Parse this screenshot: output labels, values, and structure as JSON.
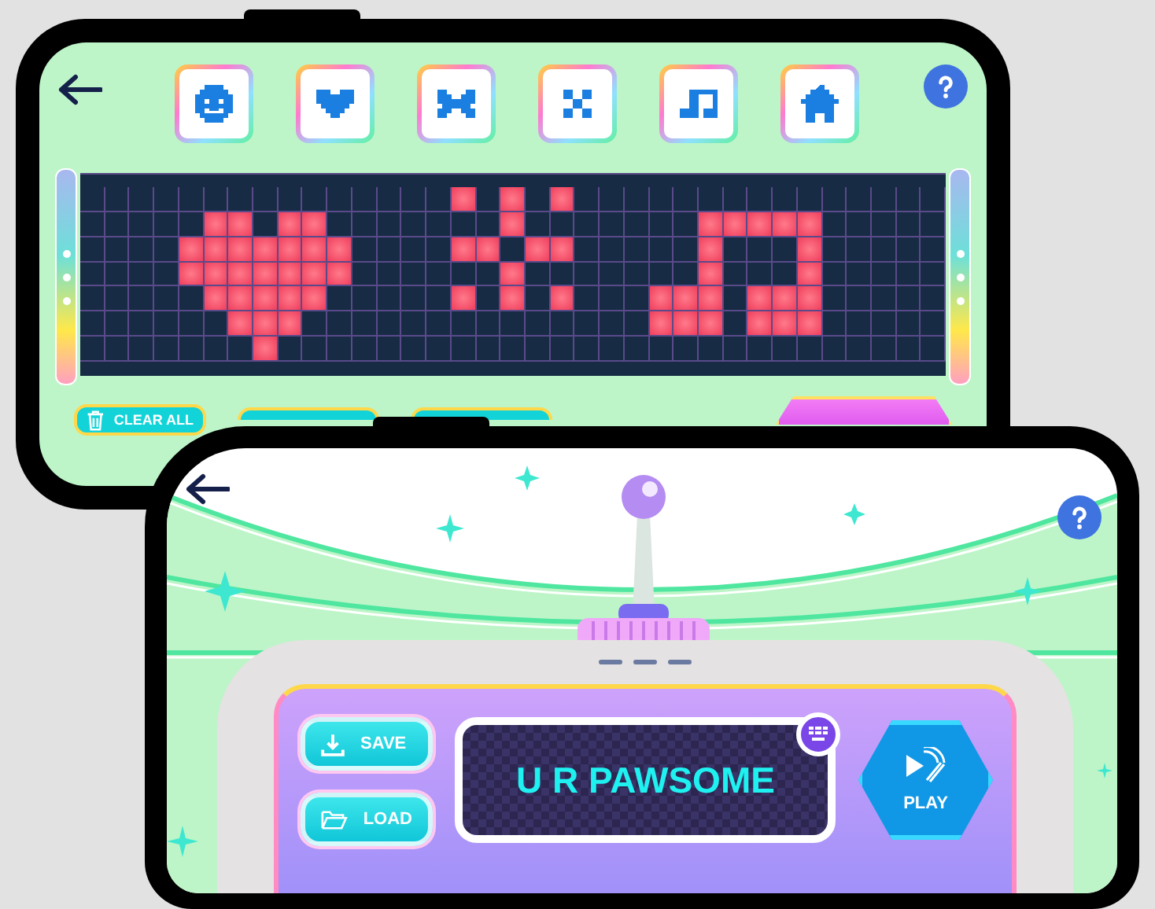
{
  "back_phone": {
    "matrix": {
      "rows": [
        {
          "cells": [
            false,
            false,
            false,
            false,
            false,
            false,
            false,
            false,
            false,
            false,
            false,
            false,
            false,
            false,
            false,
            true,
            false,
            true,
            false,
            true,
            false,
            false,
            false,
            false,
            false,
            false,
            false,
            false,
            false,
            false,
            false,
            false,
            false,
            false,
            false
          ]
        },
        {
          "cells": [
            false,
            false,
            false,
            false,
            false,
            true,
            true,
            false,
            true,
            true,
            false,
            false,
            false,
            false,
            false,
            false,
            false,
            true,
            false,
            false,
            false,
            false,
            false,
            false,
            false,
            true,
            true,
            true,
            true,
            true,
            false,
            false,
            false,
            false,
            false
          ]
        },
        {
          "cells": [
            false,
            false,
            false,
            false,
            true,
            true,
            true,
            true,
            true,
            true,
            true,
            false,
            false,
            false,
            false,
            true,
            true,
            false,
            true,
            true,
            false,
            false,
            false,
            false,
            false,
            true,
            false,
            false,
            false,
            true,
            false,
            false,
            false,
            false,
            false
          ]
        },
        {
          "cells": [
            false,
            false,
            false,
            false,
            true,
            true,
            true,
            true,
            true,
            true,
            true,
            false,
            false,
            false,
            false,
            false,
            false,
            true,
            false,
            false,
            false,
            false,
            false,
            false,
            false,
            true,
            false,
            false,
            false,
            true,
            false,
            false,
            false,
            false,
            false
          ]
        },
        {
          "cells": [
            false,
            false,
            false,
            false,
            false,
            true,
            true,
            true,
            true,
            true,
            false,
            false,
            false,
            false,
            false,
            true,
            false,
            true,
            false,
            true,
            false,
            false,
            false,
            true,
            true,
            true,
            false,
            true,
            true,
            true,
            false,
            false,
            false,
            false,
            false
          ]
        },
        {
          "cells": [
            false,
            false,
            false,
            false,
            false,
            false,
            true,
            true,
            true,
            false,
            false,
            false,
            false,
            false,
            false,
            false,
            false,
            false,
            false,
            false,
            false,
            false,
            false,
            true,
            true,
            true,
            false,
            true,
            true,
            true,
            false,
            false,
            false,
            false,
            false
          ]
        },
        {
          "cells": [
            false,
            false,
            false,
            false,
            false,
            false,
            false,
            true,
            false,
            false,
            false,
            false,
            false,
            false,
            false,
            false,
            false,
            false,
            false,
            false,
            false,
            false,
            false,
            false,
            false,
            false,
            false,
            false,
            false,
            false,
            false,
            false,
            false,
            false,
            false
          ]
        }
      ]
    },
    "clear_button": {
      "label": "CLEAR ALL"
    }
  },
  "front_phone": {
    "buttons": [
      {
        "kind": "save",
        "label": "SAVE"
      },
      {
        "kind": "load",
        "label": "LOAD"
      }
    ],
    "display_text": "U R PAWSOME",
    "play_button": {
      "label": "PLAY"
    }
  }
}
